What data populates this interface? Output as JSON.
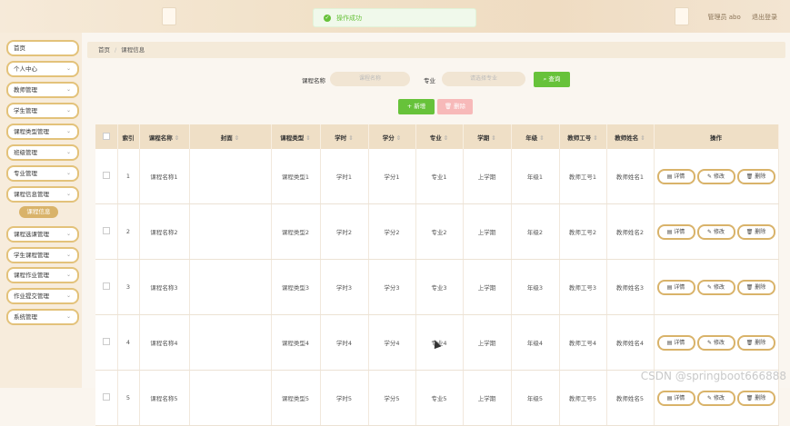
{
  "toast": {
    "message": "操作成功"
  },
  "user": {
    "role_label": "管理员 abo",
    "logout": "退出登录"
  },
  "sidebar": {
    "items": [
      {
        "label": "首页",
        "has_chevron": false
      },
      {
        "label": "个人中心",
        "has_chevron": true
      },
      {
        "label": "教师管理",
        "has_chevron": true
      },
      {
        "label": "学生管理",
        "has_chevron": true
      },
      {
        "label": "课程类型管理",
        "has_chevron": true
      },
      {
        "label": "班级管理",
        "has_chevron": true
      },
      {
        "label": "专业管理",
        "has_chevron": true
      },
      {
        "label": "课程信息管理",
        "has_chevron": true
      },
      {
        "label": "课程选课管理",
        "has_chevron": true
      },
      {
        "label": "学生课程管理",
        "has_chevron": true
      },
      {
        "label": "课程作业管理",
        "has_chevron": true
      },
      {
        "label": "作业提交管理",
        "has_chevron": true
      },
      {
        "label": "系统管理",
        "has_chevron": true
      }
    ],
    "active_sub": "课程信息"
  },
  "breadcrumb": {
    "home": "首页",
    "current": "课程信息"
  },
  "search": {
    "course_name_label": "课程名称",
    "course_name_placeholder": "课程名称",
    "major_label": "专业",
    "major_placeholder": "请选择专业",
    "query_label": "查询"
  },
  "buttons": {
    "add": "新增",
    "delete": "删除"
  },
  "table": {
    "headers": [
      "索引",
      "课程名称",
      "封面",
      "课程类型",
      "学时",
      "学分",
      "专业",
      "学期",
      "年级",
      "教师工号",
      "教师姓名",
      "操作"
    ],
    "actions": {
      "detail": "详情",
      "edit": "修改",
      "delete": "删除"
    },
    "rows": [
      {
        "index": "1",
        "name": "课程名称1",
        "type": "课程类型1",
        "hours": "学时1",
        "credit": "学分1",
        "major": "专业1",
        "term": "上学期",
        "grade": "年级1",
        "teacher_no": "教师工号1",
        "teacher_name": "教师姓名1"
      },
      {
        "index": "2",
        "name": "课程名称2",
        "type": "课程类型2",
        "hours": "学时2",
        "credit": "学分2",
        "major": "专业2",
        "term": "上学期",
        "grade": "年级2",
        "teacher_no": "教师工号2",
        "teacher_name": "教师姓名2"
      },
      {
        "index": "3",
        "name": "课程名称3",
        "type": "课程类型3",
        "hours": "学时3",
        "credit": "学分3",
        "major": "专业3",
        "term": "上学期",
        "grade": "年级3",
        "teacher_no": "教师工号3",
        "teacher_name": "教师姓名3"
      },
      {
        "index": "4",
        "name": "课程名称4",
        "type": "课程类型4",
        "hours": "学时4",
        "credit": "学分4",
        "major": "专业4",
        "term": "上学期",
        "grade": "年级4",
        "teacher_no": "教师工号4",
        "teacher_name": "教师姓名4"
      },
      {
        "index": "5",
        "name": "课程名称5",
        "type": "课程类型5",
        "hours": "学时5",
        "credit": "学分5",
        "major": "专业5",
        "term": "上学期",
        "grade": "年级5",
        "teacher_no": "教师工号5",
        "teacher_name": "教师姓名5"
      }
    ]
  },
  "watermark": "CSDN @springboot666888",
  "colors": {
    "accent": "#d9b36a",
    "success": "#67c23a",
    "danger_light": "#f7b9b9",
    "header_bg": "#efdfc6"
  }
}
